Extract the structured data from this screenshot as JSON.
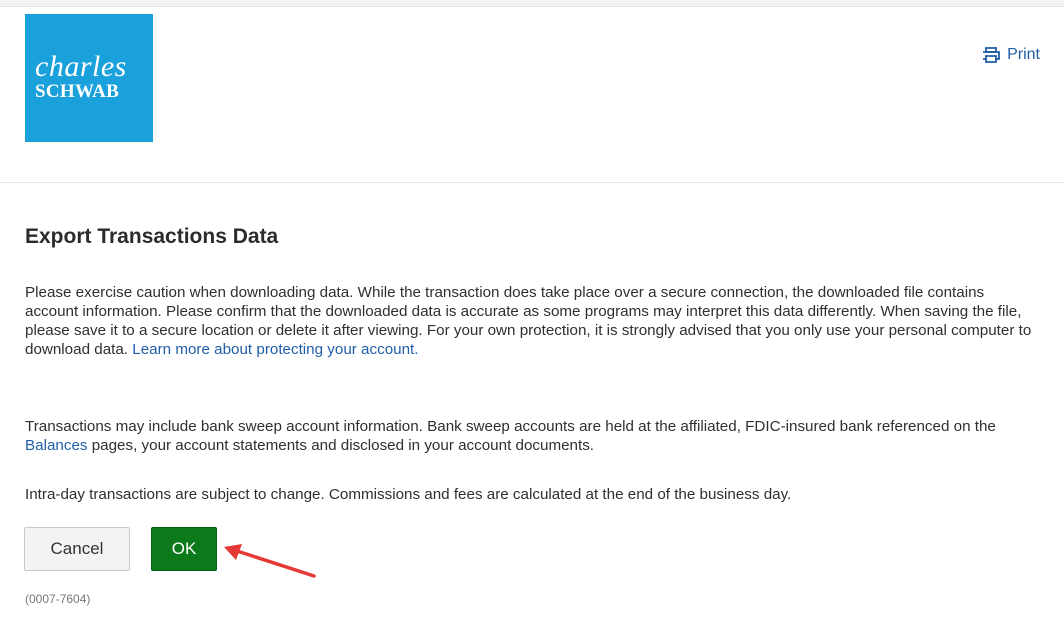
{
  "header": {
    "logo_script": "charles",
    "logo_word": "SCHWAB",
    "print_label": "Print",
    "print_icon": "printer-icon",
    "brand_color": "#1aa1dc"
  },
  "dialog": {
    "title": "Export Transactions Data",
    "paragraph1": "Please exercise caution when downloading data. While the transaction does take place over a secure connection, the downloaded file contains account information. Please confirm that the downloaded data is accurate as some programs may interpret this data differently. When saving the file, please save it to a secure location or delete it after viewing. For your own protection, it is strongly advised that you only use your personal computer to download data.",
    "paragraph1_link": "Learn more about protecting your account.",
    "paragraph2_before": "Transactions may include bank sweep account information. Bank sweep accounts are held at the affiliated, FDIC-insured bank referenced on the ",
    "paragraph2_link": "Balances",
    "paragraph2_after": " pages, your account statements and disclosed in your account documents.",
    "paragraph3": "Intra-day transactions are subject to change. Commissions and fees are calculated at the end of the business day.",
    "cancel_label": "Cancel",
    "ok_label": "OK",
    "ok_color": "#0c7a1a",
    "reference_code": "(0007-7604)"
  },
  "annotation": {
    "arrow_icon": "red-arrow-icon",
    "arrow_color": "#e53935"
  }
}
